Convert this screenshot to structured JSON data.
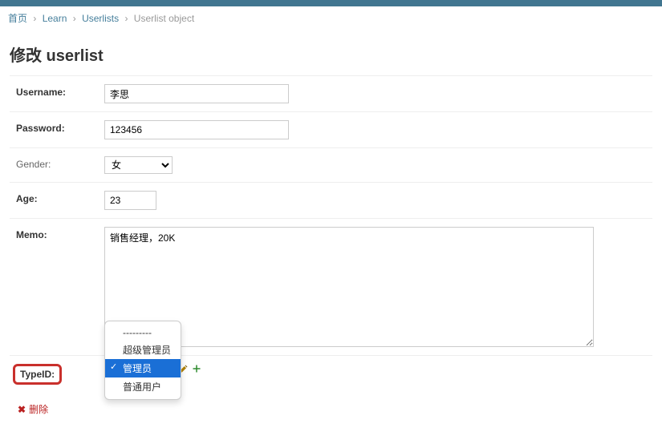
{
  "breadcrumbs": {
    "home": "首页",
    "app": "Learn",
    "model": "Userlists",
    "obj": "Userlist object",
    "sep": "›"
  },
  "heading": "修改 userlist",
  "fields": {
    "username": {
      "label": "Username:",
      "value": "李思"
    },
    "password": {
      "label": "Password:",
      "value": "123456"
    },
    "gender": {
      "label": "Gender:",
      "value": "女"
    },
    "age": {
      "label": "Age:",
      "value": "23"
    },
    "memo": {
      "label": "Memo:",
      "value": "销售经理，20K"
    },
    "typeid": {
      "label": "TypeID:"
    }
  },
  "typeid_dropdown": {
    "blank": "---------",
    "opt1": "超级管理员",
    "opt2": "管理员",
    "opt3": "普通用户",
    "selected_index": 2
  },
  "actions": {
    "delete": "删除"
  },
  "icons": {
    "pencil": "pencil-icon",
    "plus": "plus-icon"
  }
}
